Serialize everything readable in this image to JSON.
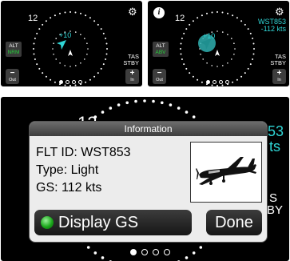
{
  "panel_normal": {
    "scale_12": "12",
    "traffic_label": "+10",
    "mode_title": "ALT",
    "mode_value": "NRM",
    "right_line1": "TAS",
    "right_line2": "STBY",
    "zoom_out": {
      "symbol": "−",
      "caption": "Out"
    },
    "zoom_in": {
      "symbol": "+",
      "caption": "In"
    },
    "page_dots": [
      true,
      false,
      false,
      false
    ]
  },
  "panel_above": {
    "scale_12": "12",
    "traffic_label": "+10",
    "flight_id": "WST853",
    "relative_alt": "-112 kts",
    "mode_title": "ALT",
    "mode_value": "ABV",
    "right_line1": "TAS",
    "right_line2": "STBY",
    "zoom_out": {
      "symbol": "−",
      "caption": "Out"
    },
    "zoom_in": {
      "symbol": "+",
      "caption": "In"
    },
    "page_dots": [
      true,
      false,
      false,
      false
    ]
  },
  "panel_info": {
    "bg_scale": "12",
    "bg_right1": "53",
    "bg_right2": "ts",
    "bg_right3": "S",
    "bg_right4": "BY",
    "dialog": {
      "title": "Information",
      "flt_id": "FLT ID: WST853",
      "type": "Type: Light",
      "gs": "GS:  112 kts",
      "display_gs_button": "Display GS",
      "done_button": "Done"
    },
    "page_dots": [
      true,
      false,
      false,
      false
    ]
  },
  "colors": {
    "traffic_cyan": "#2fd5d5",
    "mode_green": "#27d43c",
    "led_green": "#1aa71a"
  },
  "icons": [
    "gear-icon",
    "info-icon",
    "ownship-icon",
    "traffic-arrow-icon",
    "airplane-image"
  ]
}
